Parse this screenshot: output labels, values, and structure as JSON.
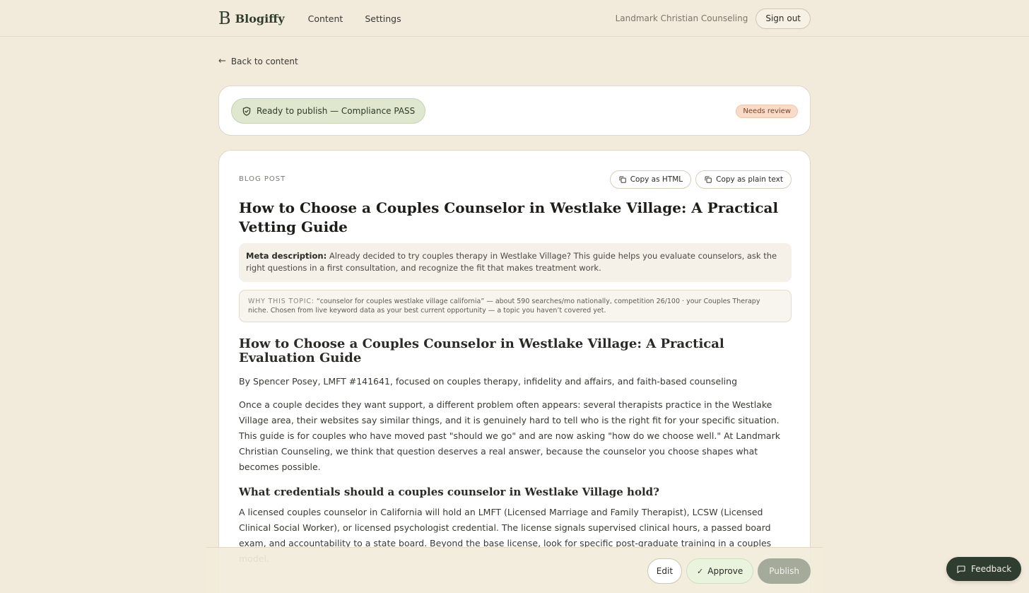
{
  "header": {
    "logo_mark": "B",
    "logo_text": "Blogiffy",
    "nav": [
      "Content",
      "Settings"
    ],
    "org_name": "Landmark Christian Counseling",
    "signout_label": "Sign out"
  },
  "back_link": "Back to content",
  "status": {
    "compliance_label": "Ready to publish — Compliance PASS",
    "review_badge": "Needs review"
  },
  "post": {
    "type_label": "BLOG POST",
    "copy_html_label": "Copy as HTML",
    "copy_text_label": "Copy as plain text",
    "title": "How to Choose a Couples Counselor in Westlake Village: A Practical Vetting Guide",
    "meta_label": "Meta description:",
    "meta_text": "Already decided to try couples therapy in Westlake Village? This guide helps you evaluate counselors, ask the right questions in a first consultation, and recognize the fit that makes treatment work.",
    "why_label": "WHY THIS TOPIC:",
    "why_text": "“counselor for couples westlake village california” — about 590 searches/mo nationally, competition 26/100 · your Couples Therapy niche. Chosen from live keyword data as your best current opportunity — a topic you haven’t covered yet.",
    "article_heading": "How to Choose a Couples Counselor in Westlake Village: A Practical Evaluation Guide",
    "byline": "By Spencer Posey, LMFT #141641, focused on couples therapy, infidelity and affairs, and faith-based counseling",
    "intro": "Once a couple decides they want support, a different problem often appears: several therapists practice in the Westlake Village area, their websites say similar things, and it is genuinely hard to tell who is the right fit for your specific situation. This guide is for couples who have moved past \"should we go\" and are now asking \"how do we choose well.\" At Landmark Christian Counseling, we think that question deserves a real answer, because the counselor you choose shapes what becomes possible.",
    "section1_heading": "What credentials should a couples counselor in Westlake Village hold?",
    "section1_text": "A licensed couples counselor in California will hold an LMFT (Licensed Marriage and Family Therapist), LCSW (Licensed Clinical Social Worker), or licensed psychologist credential. The license signals supervised clinical hours, a passed board exam, and accountability to a state board. Beyond the base license, look for specific post-graduate training in a couples model."
  },
  "actions": {
    "edit_label": "Edit",
    "approve_label": "Approve",
    "publish_label": "Publish"
  },
  "feedback_label": "Feedback"
}
